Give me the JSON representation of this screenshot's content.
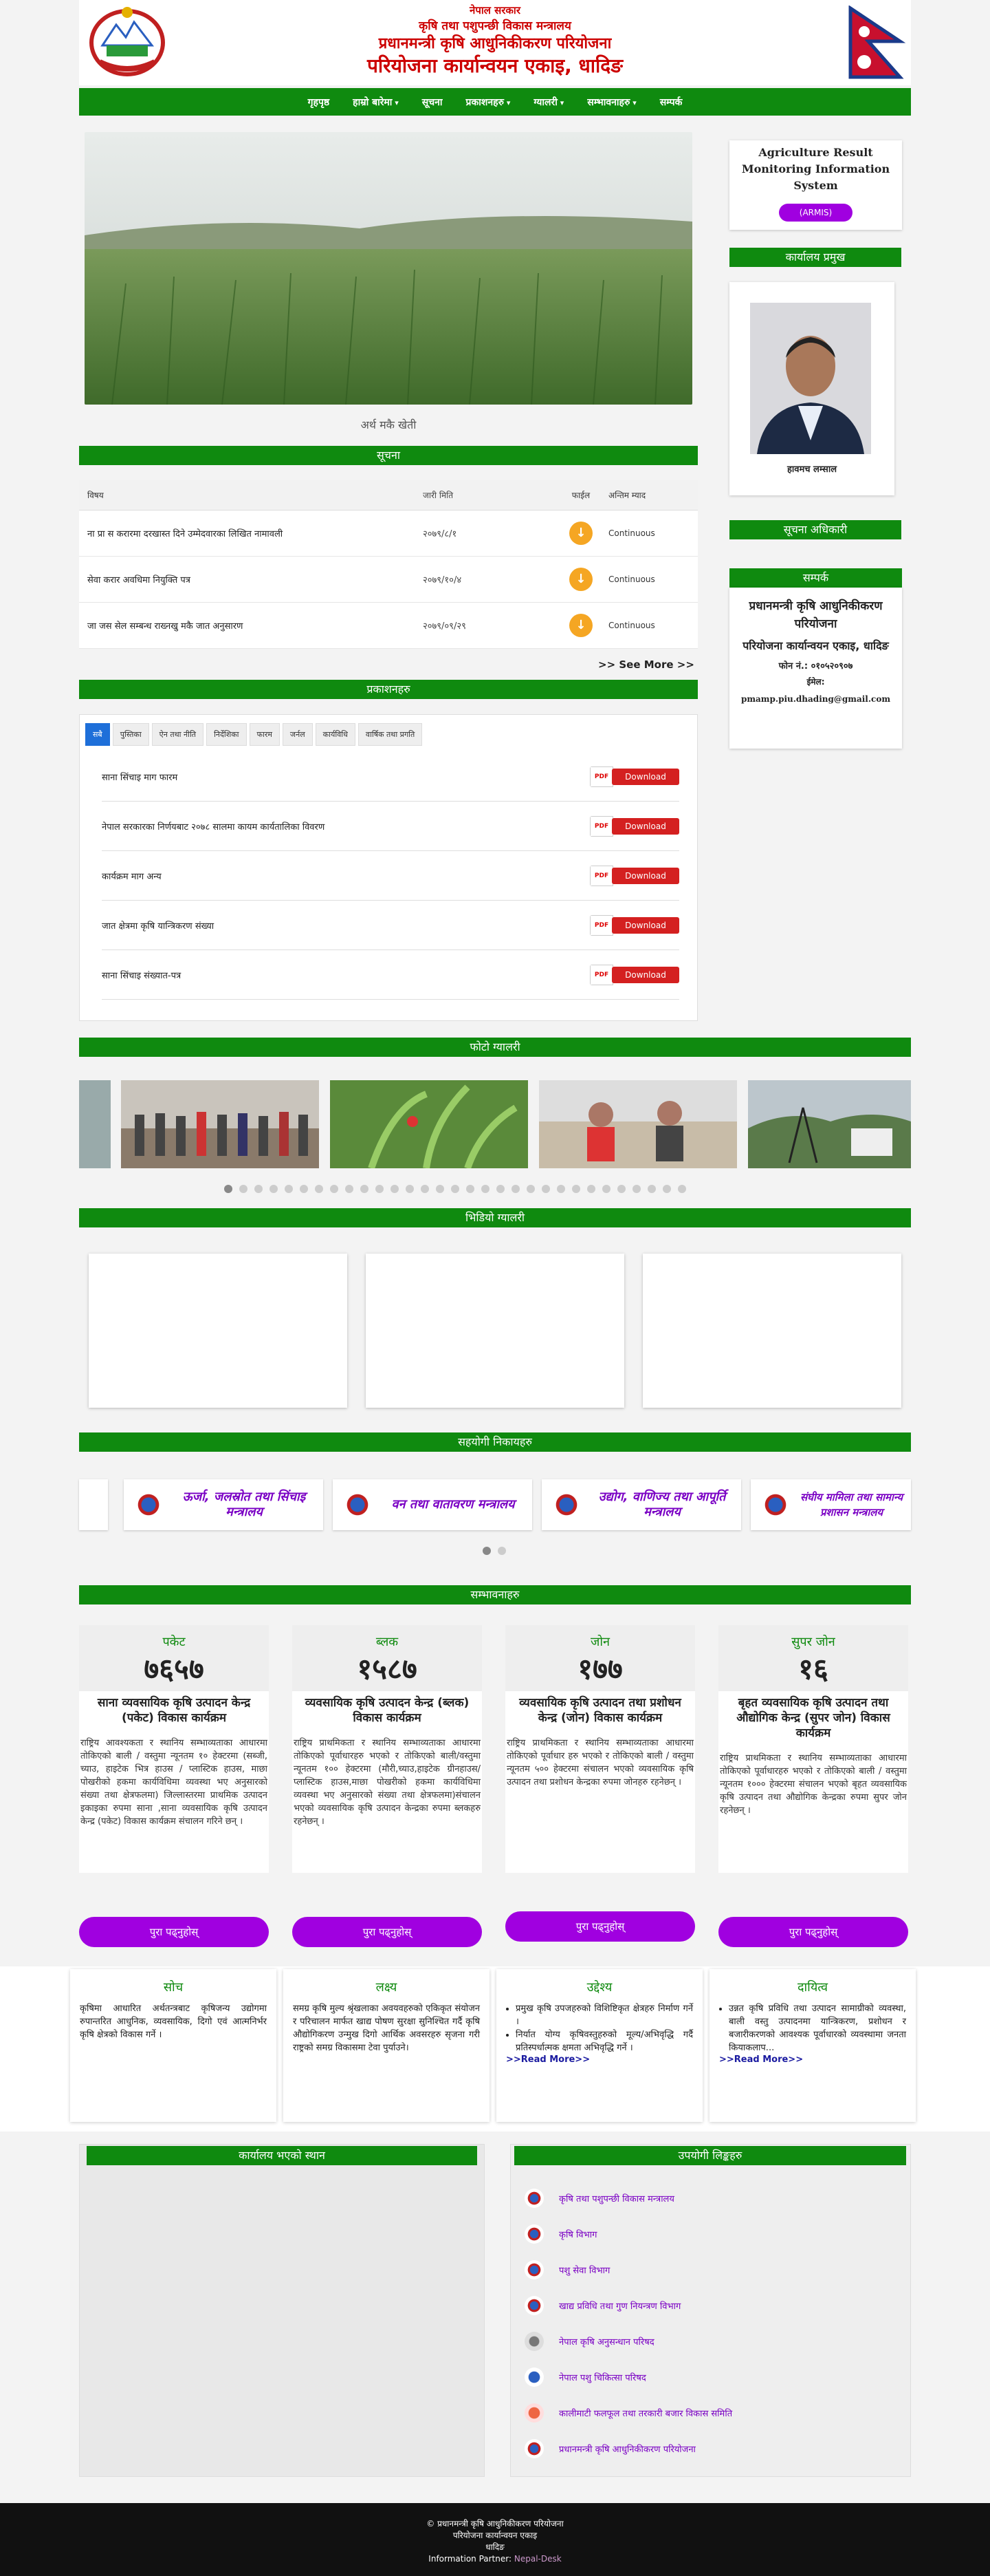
{
  "header": {
    "line1": "नेपाल सरकार",
    "line2": "कृषि तथा पशुपन्छी विकास मन्त्रालय",
    "line3": "प्रधानमन्त्री कृषि आधुनिकीकरण परियोजना",
    "line4": "परियोजना कार्यान्वयन एकाइ, धादिङ"
  },
  "nav": [
    {
      "label": "गृहपृष्ठ",
      "dropdown": false
    },
    {
      "label": "हाम्रो बारेमा",
      "dropdown": true
    },
    {
      "label": "सूचना",
      "dropdown": false
    },
    {
      "label": "प्रकाशनहरु",
      "dropdown": true
    },
    {
      "label": "ग्यालरी",
      "dropdown": true
    },
    {
      "label": "सम्भावनाहरु",
      "dropdown": true
    },
    {
      "label": "सम्पर्क",
      "dropdown": false
    }
  ],
  "slider": {
    "caption": "अर्थ मकै खेती"
  },
  "notice": {
    "heading": "सूचना",
    "columns": [
      "विषय",
      "जारी मिति",
      "फाईल",
      "अन्तिम म्याद"
    ],
    "rows": [
      {
        "title": "ना प्रा स करारमा दरखास्त दिने उम्मेदवारका लिखित नामावली",
        "date": "२०७९/८/१",
        "deadline": "Continuous"
      },
      {
        "title": "सेवा करार अवधिमा नियुक्ति पत्र",
        "date": "२०७९/१०/४",
        "deadline": "Continuous"
      },
      {
        "title": "जा जस सेल सम्बन्ध राख्नखु मकै जात अनुसारण",
        "date": "२०७९/०९/२९",
        "deadline": "Continuous"
      }
    ],
    "see_more": ">> See More >>"
  },
  "publications": {
    "heading": "प्रकाशनहरु",
    "tabs": [
      "सबै",
      "पुस्तिका",
      "ऐन तथा नीति",
      "निर्देशिका",
      "फारम",
      "जर्नल",
      "कार्यविधि",
      "वार्षिक तथा प्रगति"
    ],
    "rows": [
      {
        "title": "साना सिंचाइ माग फारम"
      },
      {
        "title": "नेपाल सरकारका निर्णयबाट २०७८ सालमा कायम कार्यतालिका विवरण"
      },
      {
        "title": "कार्यक्रम माग अन्य"
      },
      {
        "title": "जात क्षेत्रमा कृषि यान्त्रिकरण संख्या"
      },
      {
        "title": "साना सिंचाइ संख्यात-पत्र"
      }
    ],
    "download_label": "Download",
    "pdf_label": "PDF"
  },
  "armis": {
    "title": "Agriculture Result Monitoring Information System",
    "button": "(ARMIS)"
  },
  "chief": {
    "heading": "कार्यालय प्रमुख",
    "name": "हावमच लम्साल"
  },
  "info_officer": {
    "heading": "सूचना अधिकारी"
  },
  "contact": {
    "heading": "सम्पर्क",
    "org": "प्रधानमन्त्री कृषि आधुनिकीकरण परियोजना",
    "unit": "परियोजना कार्यान्वयन एकाइ, धादिङ",
    "phone": "फोन नं.: ०१०५२०९०७",
    "email_label": "ईमेल:",
    "email": "pmamp.piu.dhading@gmail.com"
  },
  "photo_gallery": {
    "heading": "फोटो ग्यालरी",
    "dot_count": 31,
    "active_dot": 0
  },
  "video_gallery": {
    "heading": "भिडियो ग्यालरी"
  },
  "partners": {
    "heading": "सहयोगी निकायहरु",
    "items": [
      "ऊर्जा, जलस्रोत तथा सिंचाइ मन्त्रालय",
      "वन तथा वातावरण मन्त्रालय",
      "उद्योग, वाणिज्य तथा आपूर्ति मन्त्रालय",
      "संघीय मामिला तथा सामान्य प्रशासन मन्त्रालय"
    ]
  },
  "potentials": {
    "heading": "सम्भावनाहरु",
    "items": [
      {
        "label": "पकेट",
        "number": "७६५७",
        "title": "साना व्यवसायिक कृषि उत्पादन केन्द्र (पकेट) विकास कार्यक्रम",
        "desc": "राष्ट्रिय आवश्यकता र स्थानिय सम्भाव्यताका आधारमा तोकिएको बाली / वस्तुमा न्यूनतम १० हेक्टरमा (सब्जी, च्याउ, हाइटेक भित्र हाउस / प्लास्टिक हाउस, माछा पोखरीको हकमा कार्यविधिमा व्यवस्था भए अनुसारको संख्या तथा क्षेत्रफलमा) जिल्लास्तरमा प्राथमिक उत्पादन इकाइका रुपमा साना ,साना व्यवसायिक कृषि उत्पादन केन्द्र (पकेट) विकास कार्यक्रम संचालन गरिने छन् ।",
        "button": "पुरा पढ्नुहोस्"
      },
      {
        "label": "ब्लक",
        "number": "१५८७",
        "title": "व्यवसायिक कृषि उत्पादन केन्द्र (ब्लक) विकास कार्यक्रम",
        "desc": "राष्ट्रिय प्राथमिकता र स्थानिय सम्भाव्यताका आधारमा तोकिएको पूर्वाधारहरु भएको र तोकिएको बाली/वस्तुमा न्यूनतम १०० हेक्टरमा (मौरी,च्याउ,हाइटेक ग्रीनहाउस/प्लास्टिक हाउस,माछा पोखरीको हकमा कार्यविधिमा व्यवस्था भए अनुसारको संख्या तथा क्षेत्रफलमा)संचालन भएको व्यवसायिक कृषि उत्पादन केन्द्रका रुपमा ब्लकहरु रहनेछन् ।",
        "button": "पुरा पढ्नुहोस्"
      },
      {
        "label": "जोन",
        "number": "१७७",
        "title": "व्यवसायिक कृषि उत्पादन तथा प्रशोधन केन्द्र (जोन) विकास कार्यक्रम",
        "desc": "राष्ट्रिय प्राथमिकता र स्थानिय सम्भाव्यताका आधारमा तोकिएको पूर्वाधार हरु भएको र तोकिएको बाली / वस्तुमा न्यूनतम ५०० हेक्टरमा संचालन भएको व्यवसायिक कृषि उत्पादन तथा प्रशोधन केन्द्रका रुपमा जोनहरु रहनेछन् ।",
        "button": "पुरा पढ्नुहोस्"
      },
      {
        "label": "सुपर जोन",
        "number": "१६",
        "title": "बृहत व्यवसायिक कृषि उत्पादन तथा औद्योगिक केन्द्र (सुपर जोन) विकास कार्यक्रम",
        "desc": "राष्ट्रिय प्राथमिकता र स्थानिय सम्भाव्यताका आधारमा तोकिएको पूर्वाधारहरु भएको र तोकिएको बाली / वस्तुमा न्यूनतम १००० हेक्टरमा संचालन भएको बृहत व्यवसायिक कृषि उत्पादन तथा औद्योगिक केन्द्रका रुपमा सुपर जोन रहनेछन् ।",
        "button": "पुरा पढ्नुहोस्"
      }
    ]
  },
  "about": [
    {
      "heading": "सोच",
      "text": "कृषिमा आधारित अर्थतन्त्रबाट कृषिजन्य उद्योगमा रुपान्तरित आधुनिक, व्यवसायिक, दिगो एवं आत्मनिर्भर कृषि क्षेत्रको विकास गर्ने ।"
    },
    {
      "heading": "लक्ष्य",
      "text": "समग्र कृषि मुल्य श्रृंखलाका अवयवहरुको एकिकृत संयोजन र परिचालन मार्फत खाद्य पोषण सुरक्षा सुनिश्चित गर्दै कृषि औद्योगिकरण उन्मुख दिगो आर्थिक अवसरहरु सृजना गरी राष्ट्रको समग्र विकासमा टेवा पुर्याउने।"
    },
    {
      "heading": "उद्देश्य",
      "items": [
        "प्रमुख कृषि उपजहरुको विशिष्टिकृत क्षेत्रहरु निर्माण गर्ने ।",
        "निर्यात योग्य कृषिवस्तुहरुको मूल्य/अभिवृद्धि गर्दै प्रतिस्पर्धात्मक क्षमता अभिवृद्धि गर्ने ।"
      ],
      "more": ">>Read More>>"
    },
    {
      "heading": "दायित्व",
      "items": [
        "उन्नत कृषि प्रविधि तथा उत्पादन सामाग्रीको व्यवस्था, बाली वस्तु उत्पादनमा यान्त्रिकरण, प्रशोधन र बजारीकरणको आवश्यक पूर्वाधारको व्यवस्थामा जनता कियाकलाप..."
      ],
      "more": ">>Read More>>"
    }
  ],
  "map": {
    "heading": "कार्यालय भएको स्थान"
  },
  "useful_links": {
    "heading": "उपयोगी लिङ्कहरु",
    "items": [
      {
        "label": "कृषि तथा पशुपन्छी विकास मन्त्रालय",
        "icon": "nepal-emblem-icon"
      },
      {
        "label": "कृषि विभाग",
        "icon": "nepal-emblem-icon"
      },
      {
        "label": "पशु सेवा विभाग",
        "icon": "nepal-emblem-icon"
      },
      {
        "label": "खाद्य प्रविधि तथा गुण नियन्त्रण विभाग",
        "icon": "nepal-emblem-icon"
      },
      {
        "label": "नेपाल कृषि अनुसन्धान परिषद",
        "icon": "narc-logo-icon"
      },
      {
        "label": "नेपाल पशु चिकित्सा परिषद",
        "icon": "vet-council-logo-icon"
      },
      {
        "label": "कालीमाटी फलफूल तथा तरकारी बजार विकास समिति",
        "icon": "kalimati-logo-icon"
      },
      {
        "label": "प्रधानमन्त्री कृषि आधुनिकीकरण परियोजना",
        "icon": "nepal-emblem-icon"
      }
    ]
  },
  "footer": {
    "copyright": "© प्रधानमन्त्री कृषि आधुनिकीकरण परियोजना",
    "unit": "परियोजना कार्यान्वयन एकाइ",
    "district": "धादिङ",
    "partner_label": "Information Partner:",
    "partner": "Nepal-Desk"
  },
  "colors": {
    "primary_green": "#0f8a0f",
    "accent_purple": "#a000e0",
    "heading_red": "#cc0000"
  }
}
